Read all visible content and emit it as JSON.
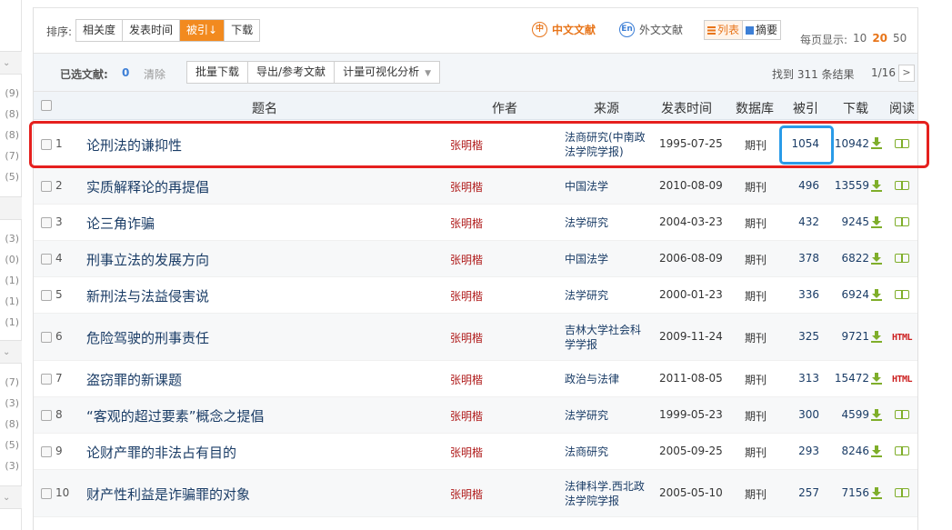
{
  "sidebar": {
    "counts": [
      "(9)",
      "(8)",
      "(8)",
      "(7)",
      "(5)",
      "(3)",
      "(0)",
      "(1)",
      "(1)",
      "(1)",
      "(7)",
      "(3)",
      "(8)",
      "(5)",
      "(3)"
    ]
  },
  "sort": {
    "label": "排序:",
    "options": [
      "相关度",
      "发表时间",
      "被引",
      "下载"
    ],
    "active_index": 2,
    "active_arrow": "↓"
  },
  "language": {
    "chinese_label": "中文文献",
    "chinese_icon": "中",
    "foreign_label": "外文文献",
    "foreign_icon": "En"
  },
  "view": {
    "list_label": "列表",
    "abstract_label": "摘要"
  },
  "per_page": {
    "label": "每页显示:",
    "options": [
      "10",
      "20",
      "50"
    ],
    "selected": "20"
  },
  "selection": {
    "label": "已选文献:",
    "count": "0",
    "clear_label": "清除",
    "batch_download": "批量下载",
    "export": "导出/参考文献",
    "visualize": "计量可视化分析"
  },
  "results": {
    "found_text": "找到 311 条结果",
    "page_text": "1/16",
    "next_symbol": ">"
  },
  "table": {
    "headers": {
      "title": "题名",
      "author": "作者",
      "source": "来源",
      "date": "发表时间",
      "database": "数据库",
      "cited": "被引",
      "downloads": "下载",
      "read": "阅读"
    },
    "rows": [
      {
        "num": "1",
        "title": "论刑法的谦抑性",
        "author": "张明楷",
        "source": "法商研究(中南政法学院学报)",
        "date": "1995-07-25",
        "db": "期刊",
        "cited": "1054",
        "downloads": "10942",
        "read": "book"
      },
      {
        "num": "2",
        "title": "实质解释论的再提倡",
        "author": "张明楷",
        "source": "中国法学",
        "date": "2010-08-09",
        "db": "期刊",
        "cited": "496",
        "downloads": "13559",
        "read": "book"
      },
      {
        "num": "3",
        "title": "论三角诈骗",
        "author": "张明楷",
        "source": "法学研究",
        "date": "2004-03-23",
        "db": "期刊",
        "cited": "432",
        "downloads": "9245",
        "read": "book"
      },
      {
        "num": "4",
        "title": "刑事立法的发展方向",
        "author": "张明楷",
        "source": "中国法学",
        "date": "2006-08-09",
        "db": "期刊",
        "cited": "378",
        "downloads": "6822",
        "read": "book"
      },
      {
        "num": "5",
        "title": "新刑法与法益侵害说",
        "author": "张明楷",
        "source": "法学研究",
        "date": "2000-01-23",
        "db": "期刊",
        "cited": "336",
        "downloads": "6924",
        "read": "book"
      },
      {
        "num": "6",
        "title": "危险驾驶的刑事责任",
        "author": "张明楷",
        "source": "吉林大学社会科学学报",
        "date": "2009-11-24",
        "db": "期刊",
        "cited": "325",
        "downloads": "9721",
        "read": "HTML"
      },
      {
        "num": "7",
        "title": "盗窃罪的新课题",
        "author": "张明楷",
        "source": "政治与法律",
        "date": "2011-08-05",
        "db": "期刊",
        "cited": "313",
        "downloads": "15472",
        "read": "HTML"
      },
      {
        "num": "8",
        "title": "“客观的超过要素”概念之提倡",
        "author": "张明楷",
        "source": "法学研究",
        "date": "1999-05-23",
        "db": "期刊",
        "cited": "300",
        "downloads": "4599",
        "read": "book"
      },
      {
        "num": "9",
        "title": "论财产罪的非法占有目的",
        "author": "张明楷",
        "source": "法商研究",
        "date": "2005-09-25",
        "db": "期刊",
        "cited": "293",
        "downloads": "8246",
        "read": "book"
      },
      {
        "num": "10",
        "title": "财产性利益是诈骗罪的对象",
        "author": "张明楷",
        "source": "法律科学.西北政法学院学报",
        "date": "2005-05-10",
        "db": "期刊",
        "cited": "257",
        "downloads": "7156",
        "read": "book"
      }
    ]
  },
  "colors": {
    "accent_orange": "#f28a1f",
    "highlight_red": "#e5201e",
    "highlight_blue": "#2a9be8",
    "author_red": "#b01c1c",
    "link_blue": "#1a3c66"
  }
}
